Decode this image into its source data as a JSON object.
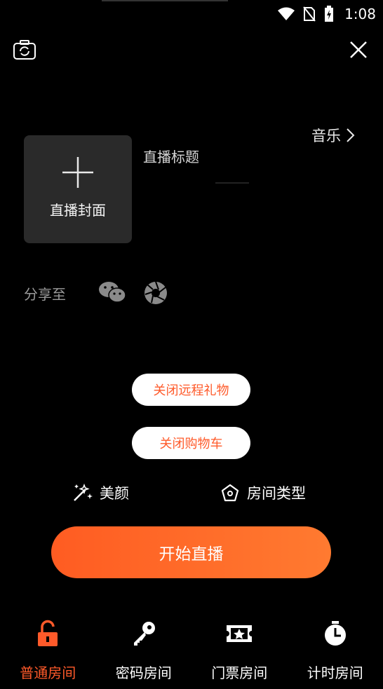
{
  "status_bar": {
    "time": "1:08"
  },
  "header": {
    "camera_icon": "camera-switch-icon",
    "close_icon": "close-icon"
  },
  "music": {
    "label": "音乐"
  },
  "cover": {
    "label": "直播封面",
    "icon": "plus-icon"
  },
  "title": {
    "placeholder": "直播标题"
  },
  "share": {
    "label": "分享至",
    "targets": [
      "wechat-icon",
      "moments-icon"
    ]
  },
  "pills": {
    "gift_label": "关闭远程礼物",
    "cart_label": "关闭购物车"
  },
  "actions": {
    "beauty_label": "美颜",
    "room_type_label": "房间类型"
  },
  "start": {
    "label": "开始直播"
  },
  "tabs": [
    {
      "label": "普通房间",
      "icon": "unlock-icon",
      "active": true
    },
    {
      "label": "密码房间",
      "icon": "key-icon",
      "active": false
    },
    {
      "label": "门票房间",
      "icon": "ticket-icon",
      "active": false
    },
    {
      "label": "计时房间",
      "icon": "timer-icon",
      "active": false
    }
  ],
  "colors": {
    "accent": "#ff5a2a",
    "start_gradient": [
      "#ff5c22",
      "#ff7a30"
    ],
    "cover_bg": "#2a2a2a"
  }
}
